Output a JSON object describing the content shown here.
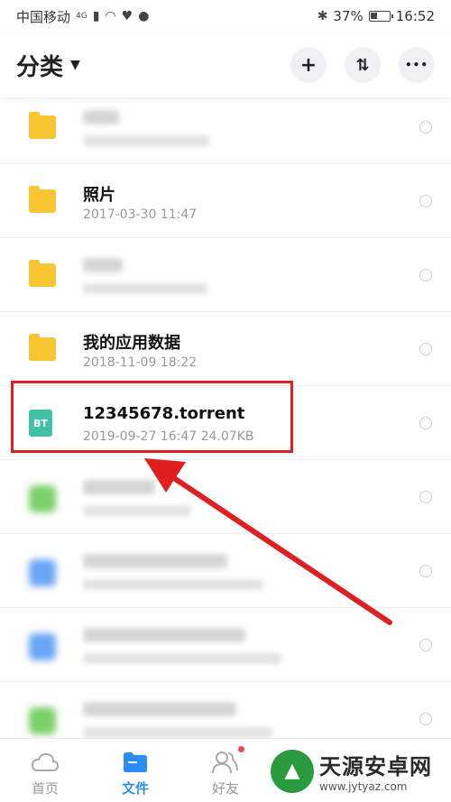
{
  "status_bar": {
    "carrier": "中国移动",
    "network": "4G",
    "battery": "37%",
    "battery_level": 0.37,
    "time": "16:52"
  },
  "header": {
    "title": "分类",
    "actions": [
      "add-icon",
      "sort-icon",
      "more-icon"
    ],
    "add_label": "+",
    "sort_label": "⇅",
    "more_label": "•••"
  },
  "files": [
    {
      "name": "",
      "meta": "",
      "type": "folder",
      "blurred": true
    },
    {
      "name": "照片",
      "meta": "2017-03-30  11:47",
      "type": "folder",
      "blurred": false
    },
    {
      "name": "",
      "meta": "",
      "type": "folder",
      "blurred": true
    },
    {
      "name": "我的应用数据",
      "meta": "2018-11-09  18:22",
      "type": "folder",
      "blurred": false
    },
    {
      "name": "12345678.torrent",
      "meta": "2019-09-27  16:47   24.07KB",
      "type": "bt",
      "icon_text": "BT",
      "blurred": false
    },
    {
      "name": "",
      "meta": "",
      "type": "green-file",
      "blurred": true
    },
    {
      "name": "",
      "meta": "",
      "type": "blue-file",
      "blurred": true
    },
    {
      "name": "",
      "meta": "",
      "type": "blue-file",
      "blurred": true
    },
    {
      "name": "",
      "meta": "",
      "type": "green-file",
      "blurred": true
    }
  ],
  "bottom_nav": [
    {
      "label": "首页",
      "icon": "cloud-icon",
      "active": false
    },
    {
      "label": "文件",
      "icon": "folder-icon",
      "active": true
    },
    {
      "label": "好友",
      "icon": "friends-icon",
      "active": false,
      "badge": true
    }
  ],
  "watermark": {
    "title": "天源安卓网",
    "url": "www.jytyaz.com"
  },
  "colors": {
    "accent": "#2b8cf3",
    "folder": "#f7c531",
    "bt": "#3fc1a3",
    "annotation": "#e02020"
  }
}
